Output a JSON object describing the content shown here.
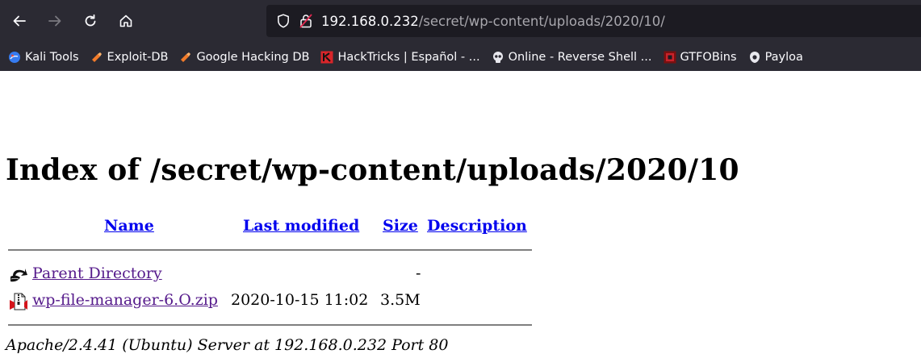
{
  "browser": {
    "address_bar": {
      "host": "192.168.0.232",
      "path": "/secret/wp-content/uploads/2020/10/"
    },
    "bookmarks": [
      {
        "label": "Kali Tools",
        "icon": "kali-icon"
      },
      {
        "label": "Exploit-DB",
        "icon": "exploit-db-icon"
      },
      {
        "label": "Google Hacking DB",
        "icon": "ghdb-icon"
      },
      {
        "label": "HackTricks | Español - ...",
        "icon": "hacktricks-icon"
      },
      {
        "label": "Online - Reverse Shell ...",
        "icon": "skull-icon"
      },
      {
        "label": "GTFOBins",
        "icon": "gtfobins-icon"
      },
      {
        "label": "Payloa",
        "icon": "payloads-icon"
      }
    ]
  },
  "page": {
    "title": "Index of /secret/wp-content/uploads/2020/10",
    "columns": {
      "name": "Name",
      "last_modified": "Last modified",
      "size": "Size",
      "description": "Description"
    },
    "rows": [
      {
        "name": "Parent Directory",
        "last_modified": "",
        "size": "-",
        "description": "",
        "icon": "back-arrow-icon"
      },
      {
        "name": "wp-file-manager-6.O.zip",
        "last_modified": "2020-10-15 11:02",
        "size": "3.5M",
        "description": "",
        "icon": "compressed-file-icon"
      }
    ],
    "footer": "Apache/2.4.41 (Ubuntu) Server at 192.168.0.232 Port 80"
  }
}
